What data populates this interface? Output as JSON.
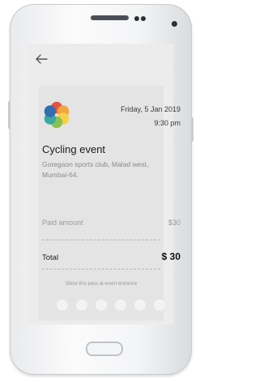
{
  "event": {
    "date": "Friday, 5 Jan 2019",
    "time": "9:30 pm",
    "title": "Cycling event",
    "address": "Goregaon sports club, Malad west, Mumbai-64.",
    "paid_label": "Paid amount",
    "paid_value": "$30",
    "total_label": "Total",
    "total_value": "$ 30",
    "pass_note": "Show this pass at event entrance"
  },
  "icons": {
    "back": "back-arrow-icon",
    "logo": "flower-logo-icon"
  },
  "colors": {
    "screen_bg": "#ececec",
    "card_bg": "#e4e4e5",
    "logo_petals": [
      "#e8523f",
      "#f2a53a",
      "#f7d04a",
      "#8cc152",
      "#3aa8a0",
      "#2f6fb0"
    ]
  }
}
